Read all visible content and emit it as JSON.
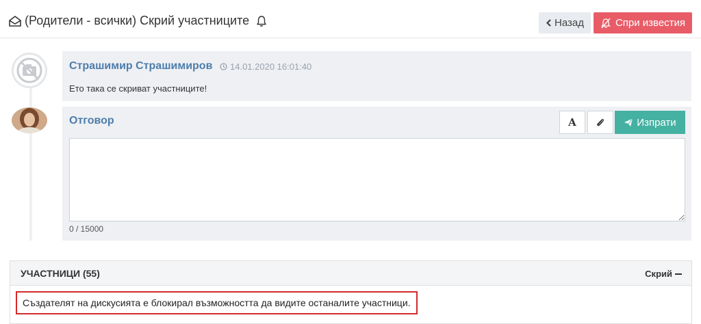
{
  "header": {
    "title": "(Родители - всички) Скрий участниците",
    "back_label": "Назад",
    "stop_notifications_label": "Спри известия"
  },
  "post": {
    "author": "Страшимир Страшимиров",
    "timestamp": "14.01.2020 16:01:40",
    "text": "Ето така се скриват участниците!"
  },
  "reply": {
    "label": "Отговор",
    "format_label": "A",
    "send_label": "Изпрати",
    "input_value": "",
    "counter": "0 / 15000"
  },
  "participants": {
    "title": "УЧАСТНИЦИ (55)",
    "hide_label": "Скрий",
    "blocked_message": "Създателят на дискусията е блокирал възможността да видите останалите участници."
  },
  "colors": {
    "accent_blue": "#4d7dab",
    "danger": "#e85c68",
    "send": "#45b1a3",
    "highlight_border": "#d32a2a"
  },
  "icons": [
    "envelope-open-icon",
    "bell-icon",
    "chevron-left-icon",
    "bell-slash-icon",
    "no-photo-icon",
    "clock-icon",
    "paperclip-icon",
    "paper-plane-icon",
    "minus-icon"
  ]
}
